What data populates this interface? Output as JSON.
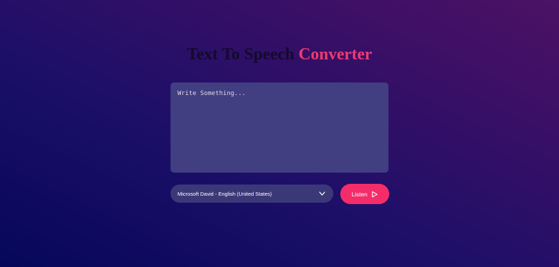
{
  "title": {
    "part1": "Text To Speech ",
    "part2": "Converter"
  },
  "textarea": {
    "placeholder": "Write Something..."
  },
  "voice_select": {
    "selected": "Microsoft David - English (United States)",
    "icon": "chevron-down-icon"
  },
  "listen_button": {
    "label": "Listen",
    "icon": "play-icon"
  },
  "colors": {
    "accent": "#f42d6a",
    "panel": "#413e81",
    "background_start": "#06075a",
    "background_end": "#4c1265"
  }
}
